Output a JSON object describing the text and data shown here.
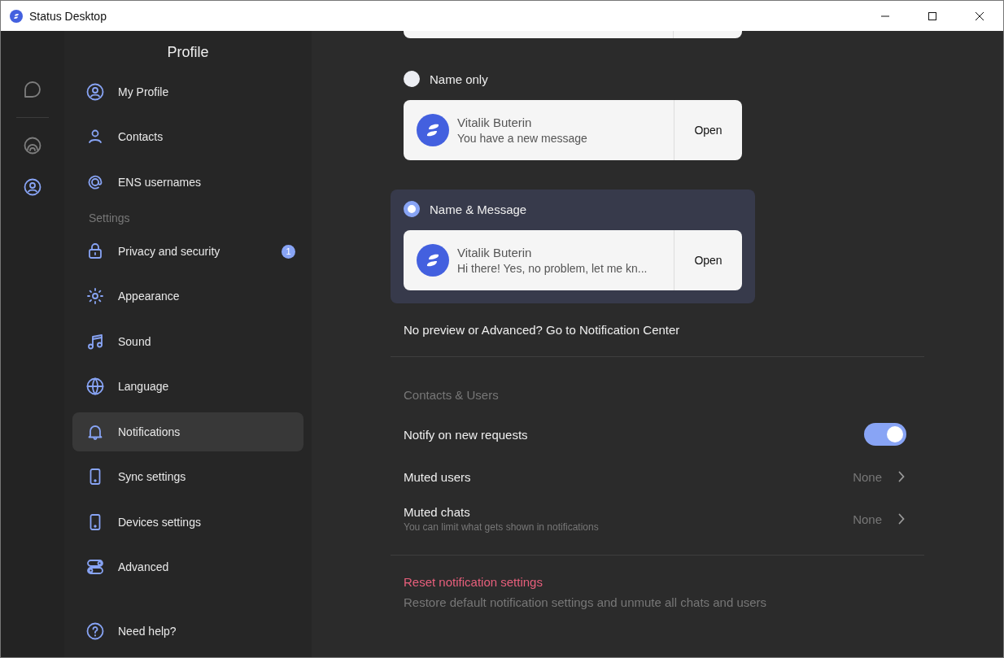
{
  "window": {
    "title": "Status Desktop"
  },
  "rail": {
    "items": [
      {
        "selected": false
      },
      {
        "selected": false
      },
      {
        "selected": true
      }
    ]
  },
  "sidebar": {
    "title": "Profile",
    "items": [
      {
        "kind": "item",
        "label": "My Profile",
        "selected": false
      },
      {
        "kind": "item",
        "label": "Contacts",
        "selected": false
      },
      {
        "kind": "item",
        "label": "ENS usernames",
        "selected": false
      },
      {
        "kind": "heading",
        "label": "Settings"
      },
      {
        "kind": "item",
        "label": "Privacy and security",
        "selected": false,
        "badge": "1"
      },
      {
        "kind": "item",
        "label": "Appearance",
        "selected": false
      },
      {
        "kind": "item",
        "label": "Sound",
        "selected": false
      },
      {
        "kind": "item",
        "label": "Language",
        "selected": false
      },
      {
        "kind": "item",
        "label": "Notifications",
        "selected": true
      },
      {
        "kind": "item",
        "label": "Sync settings",
        "selected": false
      },
      {
        "kind": "item",
        "label": "Devices settings",
        "selected": false
      },
      {
        "kind": "item",
        "label": "Advanced",
        "selected": false
      },
      {
        "kind": "spacer"
      },
      {
        "kind": "item",
        "label": "Need help?",
        "selected": false
      }
    ]
  },
  "preview_options": [
    {
      "label": "Name only",
      "selected": false,
      "card": {
        "name": "Vitalik Buterin",
        "message": "You have a new message",
        "action": "Open"
      }
    },
    {
      "label": "Name & Message",
      "selected": true,
      "card": {
        "name": "Vitalik Buterin",
        "message": "Hi there! Yes, no problem, let me kn...",
        "action": "Open"
      }
    }
  ],
  "notification_center_link": "No preview or Advanced? Go to Notification Center",
  "contacts_section": {
    "heading": "Contacts & Users",
    "rows": [
      {
        "kind": "toggle",
        "label": "Notify on new requests",
        "on": true
      },
      {
        "kind": "link",
        "label": "Muted users",
        "value": "None"
      },
      {
        "kind": "link",
        "label": "Muted chats",
        "value": "None",
        "hint": "You can limit what gets shown in notifications"
      }
    ]
  },
  "reset": {
    "label": "Reset notification settings",
    "description": "Restore default notification settings and unmute all chats and users"
  }
}
